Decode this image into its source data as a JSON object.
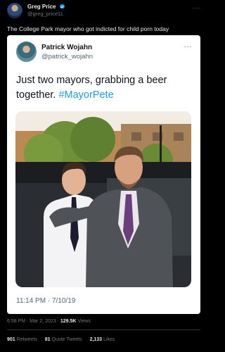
{
  "tweet": {
    "author_name": "Greg Price",
    "author_handle": "@greg_price11",
    "text": "The College Park mayor who got indicted for child porn today",
    "more_label": "···",
    "timestamp": "6:58 PM · Mar 2, 2023 ·",
    "views_count": "129.5K",
    "views_label": "Views",
    "retweets_count": "901",
    "retweets_label": "Retweets",
    "quotes_count": "81",
    "quotes_label": "Quote Tweets",
    "likes_count": "2,133",
    "likes_label": "Likes"
  },
  "quoted": {
    "author_name": "Patrick Wojahn",
    "author_handle": "@patrick_wojahn",
    "more_label": "···",
    "text_main": "Just two mayors, grabbing a beer together. ",
    "hashtag": "#MayorPete",
    "timestamp": "11:14 PM · 7/10/19"
  },
  "colors": {
    "background": "#000000",
    "accent": "#1d9bf0",
    "verified": "#1d9bf0"
  }
}
